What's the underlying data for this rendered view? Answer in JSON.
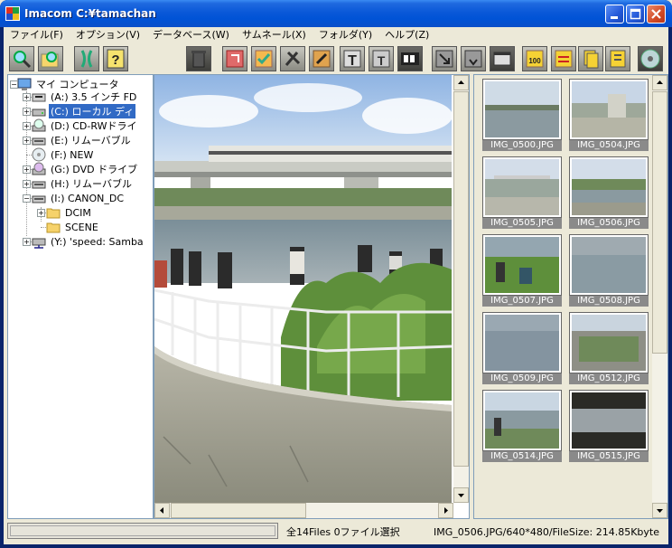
{
  "window": {
    "title": "Imacom C:¥tamachan"
  },
  "menu": [
    "ファイル(F)",
    "オプション(V)",
    "データベース(W)",
    "サムネール(X)",
    "フォルダ(Y)",
    "ヘルプ(Z)"
  ],
  "toolbar_icons": [
    "search-icon",
    "search-folder-icon",
    "link-icon",
    "help-icon",
    "trash-icon",
    "rotate-icon",
    "check-icon",
    "tools-icon",
    "edit-icon",
    "text-icon",
    "text-rotate-icon",
    "film-icon",
    "resize-icon",
    "resize-down-icon",
    "window-icon",
    "stamp-100-icon",
    "swap-icon",
    "copy-icon",
    "tag-icon",
    "disc-icon"
  ],
  "tree": {
    "root": "マイ コンピュータ",
    "items": [
      {
        "label": "(A:) 3.5 インチ FD",
        "icon": "floppy-drive-icon"
      },
      {
        "label": "(C:) ローカル ディ",
        "icon": "hard-drive-icon",
        "selected": true
      },
      {
        "label": "(D:) CD-RWドライ",
        "icon": "cd-drive-icon"
      },
      {
        "label": "(E:) リムーバブル",
        "icon": "removable-drive-icon"
      },
      {
        "label": "(F:) NEW",
        "icon": "cd-icon"
      },
      {
        "label": "(G:) DVD ドライブ",
        "icon": "dvd-drive-icon"
      },
      {
        "label": "(H:) リムーバブル",
        "icon": "removable-drive-icon"
      },
      {
        "label": "(I:) CANON_DC",
        "icon": "removable-drive-icon"
      },
      {
        "label": "DCIM",
        "icon": "folder-icon"
      },
      {
        "label": "SCENE",
        "icon": "folder-icon"
      },
      {
        "label": "(Y:) 'speed: Samba",
        "icon": "network-drive-icon"
      }
    ]
  },
  "thumbnails": [
    {
      "name": "IMG_0500.JPG"
    },
    {
      "name": "IMG_0504.JPG"
    },
    {
      "name": "IMG_0505.JPG"
    },
    {
      "name": "IMG_0506.JPG"
    },
    {
      "name": "IMG_0507.JPG"
    },
    {
      "name": "IMG_0508.JPG"
    },
    {
      "name": "IMG_0509.JPG"
    },
    {
      "name": "IMG_0512.JPG"
    },
    {
      "name": "IMG_0514.JPG"
    },
    {
      "name": "IMG_0515.JPG"
    }
  ],
  "status": {
    "count": "全14Files  0ファイル選択",
    "info": "IMG_0506.JPG/640*480/FileSize: 214.85Kbyte"
  },
  "colors": {
    "titlebar": "#0053d6",
    "selection": "#316ac5",
    "caption_bg": "#8a8a8a"
  }
}
